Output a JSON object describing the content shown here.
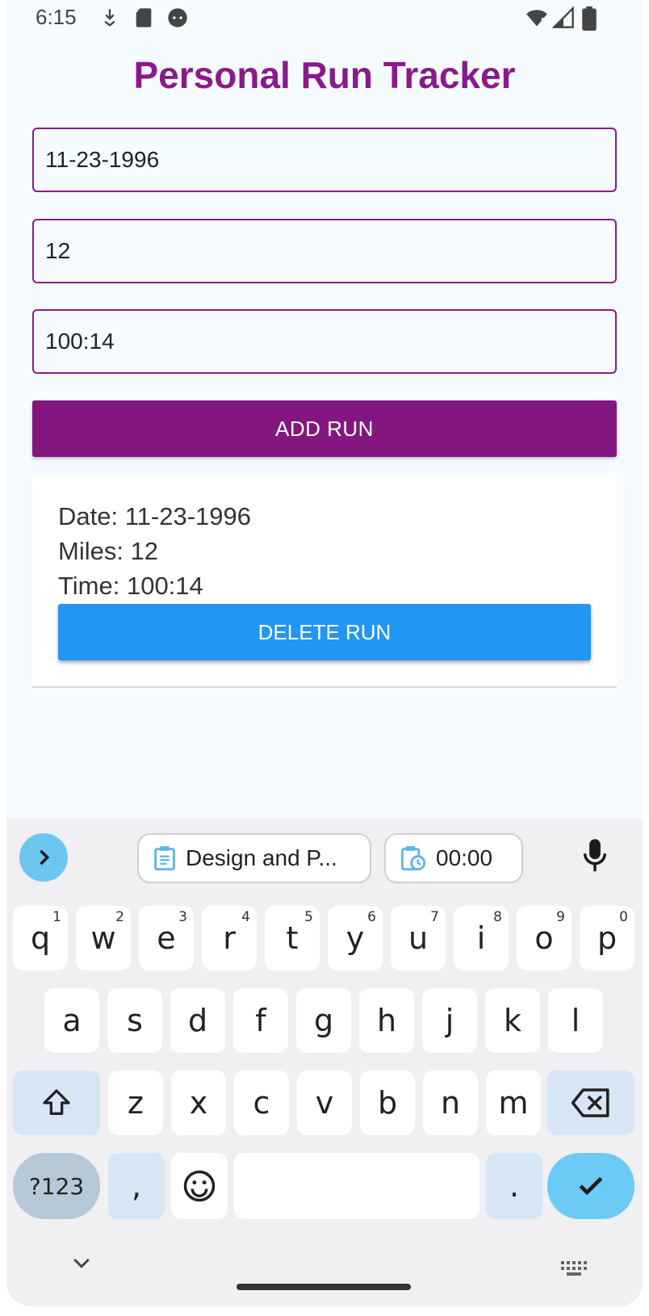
{
  "status_bar": {
    "time": "6:15"
  },
  "app": {
    "title": "Personal Run Tracker",
    "fields": {
      "date": "11-23-1996",
      "miles": "12",
      "time": "100:14"
    },
    "add_button": "ADD RUN",
    "runs": [
      {
        "date_line": "Date: 11-23-1996",
        "miles_line": "Miles: 12",
        "time_line": "Time: 100:14",
        "delete_button": "DELETE RUN"
      }
    ]
  },
  "keyboard": {
    "suggestions": [
      {
        "icon": "clipboard-icon",
        "label": "Design and P..."
      },
      {
        "icon": "clipboard-clock-icon",
        "label": "00:00"
      }
    ],
    "rows": [
      [
        {
          "k": "q",
          "s": "1"
        },
        {
          "k": "w",
          "s": "2"
        },
        {
          "k": "e",
          "s": "3"
        },
        {
          "k": "r",
          "s": "4"
        },
        {
          "k": "t",
          "s": "5"
        },
        {
          "k": "y",
          "s": "6"
        },
        {
          "k": "u",
          "s": "7"
        },
        {
          "k": "i",
          "s": "8"
        },
        {
          "k": "o",
          "s": "9"
        },
        {
          "k": "p",
          "s": "0"
        }
      ],
      [
        {
          "k": "a"
        },
        {
          "k": "s"
        },
        {
          "k": "d"
        },
        {
          "k": "f"
        },
        {
          "k": "g"
        },
        {
          "k": "h"
        },
        {
          "k": "j"
        },
        {
          "k": "k"
        },
        {
          "k": "l"
        }
      ],
      [
        {
          "k": "z"
        },
        {
          "k": "x"
        },
        {
          "k": "c"
        },
        {
          "k": "v"
        },
        {
          "k": "b"
        },
        {
          "k": "n"
        },
        {
          "k": "m"
        }
      ]
    ],
    "symbols_key": "?123",
    "comma_key": ",",
    "period_key": "."
  },
  "colors": {
    "accent": "#84177f",
    "delete": "#2196f3",
    "background": "#f5fbff"
  }
}
